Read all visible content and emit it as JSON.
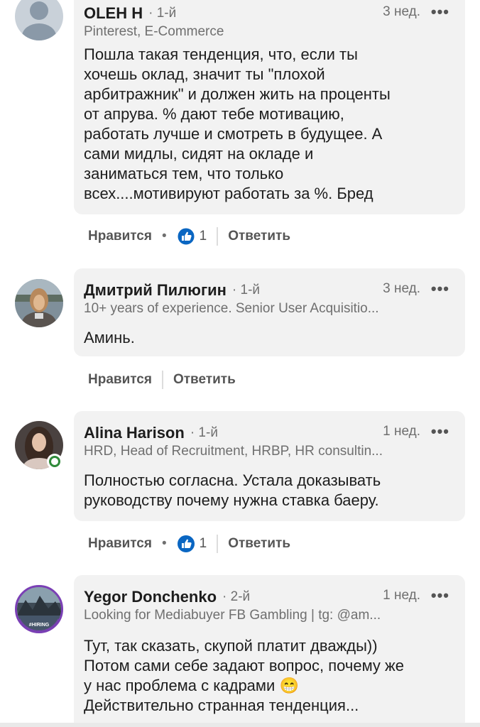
{
  "comments": [
    {
      "name": "OLEH H",
      "degree": "· 1-й",
      "time": "3 нед.",
      "headline": "Pinterest, E-Commerce",
      "text_lines": [
        "Пошла такая тенденция, что, если ты",
        "хочешь оклад, значит ты \"плохой",
        "арбитражник\" и должен жить на проценты",
        "от апрува. % дают тебе мотивацию,",
        "работать лучше и смотреть в будущее. А",
        "сами мидлы, сидят на окладе и",
        "заниматься тем, что только",
        "всех....мотивируют работать за %. Бред"
      ],
      "like_label": "Нравится",
      "reaction_count": "1",
      "reply_label": "Ответить"
    },
    {
      "name": "Дмитрий Пилюгин",
      "degree": "· 1-й",
      "time": "3 нед.",
      "headline": "10+ years of experience. Senior User Acquisitio...",
      "text_lines": [
        "Аминь."
      ],
      "like_label": "Нравится",
      "reply_label": "Ответить"
    },
    {
      "name": "Alina Harison",
      "degree": "· 1-й",
      "time": "1 нед.",
      "headline": "HRD, Head of Recruitment, HRBP, HR consultin...",
      "text_lines": [
        "Полностью согласна. Устала доказывать",
        "руководству почему нужна ставка баеру."
      ],
      "like_label": "Нравится",
      "reaction_count": "1",
      "reply_label": "Ответить"
    },
    {
      "name": "Yegor Donchenko",
      "degree": "· 2-й",
      "time": "1 нед.",
      "headline": "Looking for Mediabuyer FB Gambling | tg: @am...",
      "avatar_badge": "#HIRING",
      "text_lines": [
        "Тут, так сказать, скупой платит дважды))",
        "Потом сами себе задают вопрос, почему же",
        "у нас проблема с кадрами 😁",
        "Действительно странная тенденция..."
      ]
    }
  ],
  "more_glyph": "•••",
  "colors": {
    "bubble": "#f2f2f2",
    "like_blue": "#0a66c2",
    "online_green": "#2f8a3a",
    "hiring_purple": "#7a3fb5"
  },
  "icons": [
    "like-reaction-icon",
    "more-options-icon",
    "online-status-icon"
  ]
}
